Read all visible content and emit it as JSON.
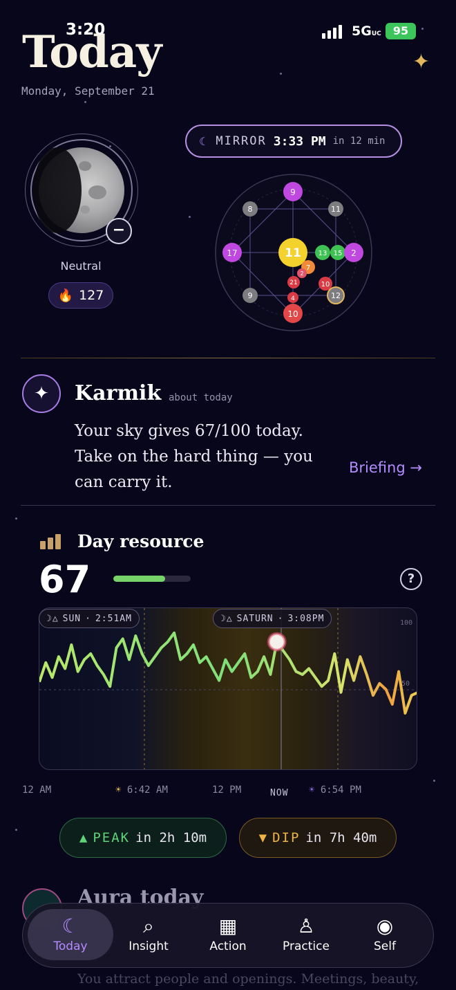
{
  "status": {
    "time": "3:20",
    "network": "5G",
    "network_suffix": "UC",
    "battery": "95"
  },
  "header": {
    "title": "Today",
    "date": "Monday, September 21"
  },
  "moon": {
    "phase_label": "Neutral",
    "streak": "127",
    "toggle": "−"
  },
  "mirror": {
    "label": "MIRROR",
    "time": "3:33 PM",
    "relative": "in 12 min"
  },
  "numerology_chart": {
    "nodes": [
      "9",
      "8",
      "11",
      "17",
      "11",
      "13",
      "15",
      "2",
      "7",
      "2",
      "21",
      "10",
      "9",
      "4",
      "12",
      "10"
    ]
  },
  "karmik": {
    "name": "Karmik",
    "about": "about today",
    "line1": "Your sky gives 67/100 today.",
    "line2": "Take on the hard thing — you",
    "line3": "can carry it.",
    "cta": "Briefing"
  },
  "resource": {
    "title": "Day resource",
    "value": "67",
    "fill": 0.67,
    "help": "?"
  },
  "chart_data": {
    "type": "line",
    "title": "",
    "ylim": [
      0,
      100
    ],
    "y_ticks": [
      "100",
      "50"
    ],
    "x_labels": [
      "12 AM",
      "6:42 AM",
      "12 PM",
      "NOW",
      "6:54 PM"
    ],
    "tags": [
      {
        "label": "SUN",
        "time": "2:51AM"
      },
      {
        "label": "SATURN",
        "time": "3:08PM"
      }
    ],
    "series": [
      {
        "values": [
          55,
          68,
          58,
          72,
          64,
          80,
          62,
          70,
          74,
          66,
          60,
          52,
          78,
          84,
          70,
          86,
          74,
          66,
          72,
          78,
          82,
          88,
          70,
          74,
          80,
          68,
          72,
          64,
          56,
          70,
          62,
          68,
          74,
          58,
          62,
          72,
          60,
          82,
          76,
          70,
          62,
          60,
          64,
          58,
          52,
          56,
          74,
          48,
          70,
          56,
          72,
          60,
          46,
          54,
          50,
          40,
          62,
          34,
          46,
          48
        ]
      }
    ],
    "now_index": 37
  },
  "peak": {
    "label": "PEAK",
    "text": "in 2h 10m"
  },
  "dip": {
    "label": "DIP",
    "text": "in 7h 40m"
  },
  "aura": {
    "title": "Aura today",
    "subtitle": "You attract people and openings. Meetings, beauty,"
  },
  "tabs": [
    {
      "label": "Today",
      "icon": "moon-sparkle-icon"
    },
    {
      "label": "Insight",
      "icon": "magnifier-icon"
    },
    {
      "label": "Action",
      "icon": "calendar-icon"
    },
    {
      "label": "Practice",
      "icon": "meditation-icon"
    },
    {
      "label": "Self",
      "icon": "profile-icon"
    }
  ]
}
